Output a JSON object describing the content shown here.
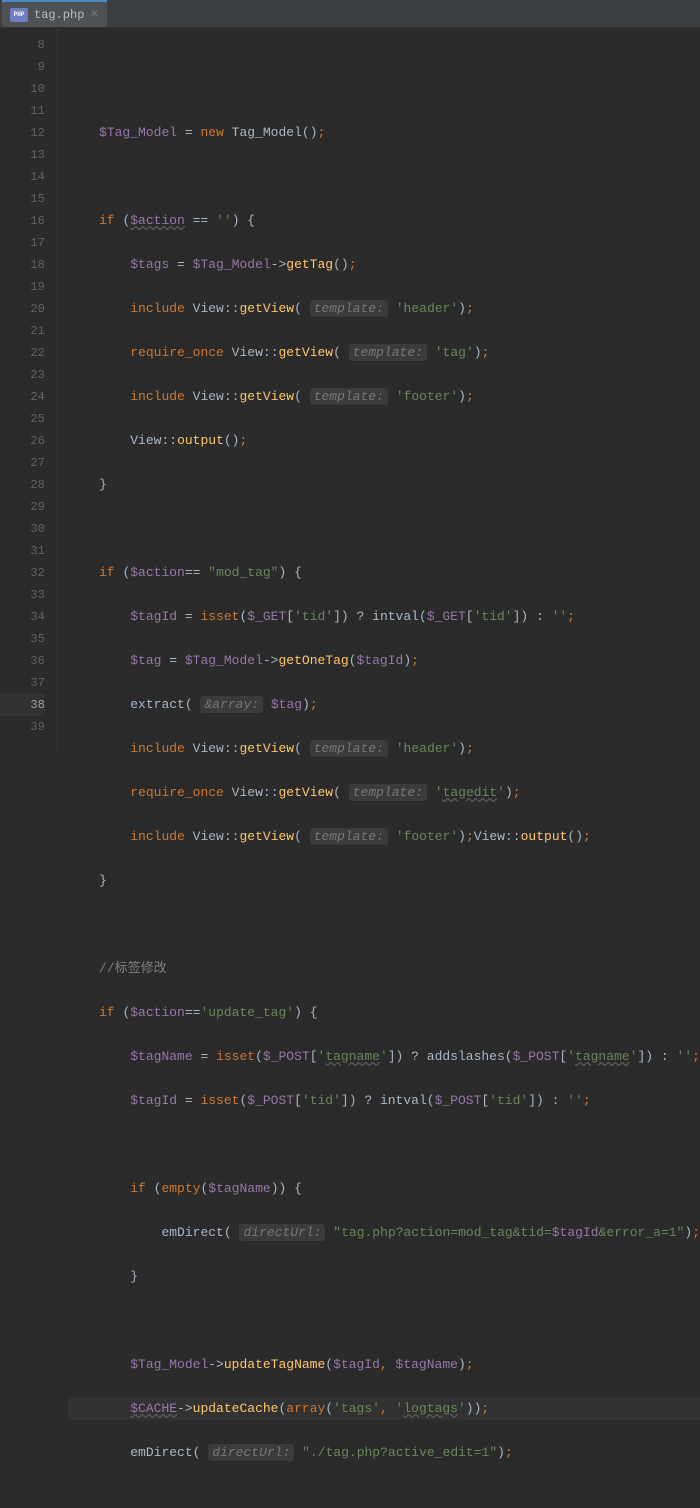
{
  "tab": {
    "filename": "tag.php",
    "icon_label": "PHP"
  },
  "lines": {
    "start": 8,
    "end": 39,
    "highlight": 38
  },
  "code": {
    "l9_var": "$Tag_Model",
    "l9_new": "new",
    "l9_cls": "Tag_Model",
    "l11_if": "if",
    "l11_var": "$action",
    "l11_eq": " == ",
    "l11_str": "''",
    "l12_var": "$tags",
    "l12_tm": "$Tag_Model",
    "l12_fn": "getTag",
    "l13_inc": "include",
    "l13_cls": "View",
    "l13_fn": "getView",
    "l13_hint": "template:",
    "l13_str": "'header'",
    "l14_req": "require_once",
    "l14_cls": "View",
    "l14_fn": "getView",
    "l14_hint": "template:",
    "l14_str": "'tag'",
    "l15_inc": "include",
    "l15_cls": "View",
    "l15_fn": "getView",
    "l15_hint": "template:",
    "l15_str": "'footer'",
    "l16_cls": "View",
    "l16_fn": "output",
    "l19_if": "if",
    "l19_var": "$action",
    "l19_eq": "== ",
    "l19_str": "\"mod_tag\"",
    "l20_var": "$tagId",
    "l20_isset": "isset",
    "l20_get": "$_GET",
    "l20_k": "'tid'",
    "l20_intval": "intval",
    "l20_emp": "''",
    "l21_var": "$tag",
    "l21_tm": "$Tag_Model",
    "l21_fn": "getOneTag",
    "l21_arg": "$tagId",
    "l22_fn": "extract",
    "l22_hint": "&array:",
    "l22_arg": "$tag",
    "l23_inc": "include",
    "l23_cls": "View",
    "l23_fn": "getView",
    "l23_hint": "template:",
    "l23_str": "'header'",
    "l24_req": "require_once",
    "l24_cls": "View",
    "l24_fn": "getView",
    "l24_hint": "template:",
    "l24_str": "tagedit",
    "l25_inc": "include",
    "l25_cls": "View",
    "l25_fn": "getView",
    "l25_hint": "template:",
    "l25_str": "'footer'",
    "l25_cls2": "View",
    "l25_fn2": "output",
    "l28_comment": "//标签修改",
    "l29_if": "if",
    "l29_var": "$action",
    "l29_eq": "==",
    "l29_str": "'update_tag'",
    "l30_var": "$tagName",
    "l30_isset": "isset",
    "l30_post": "$_POST",
    "l30_k": "tagname",
    "l30_fn": "addslashes",
    "l30_emp": "''",
    "l31_var": "$tagId",
    "l31_isset": "isset",
    "l31_post": "$_POST",
    "l31_k": "'tid'",
    "l31_intval": "intval",
    "l31_emp": "''",
    "l33_if": "if",
    "l33_fn": "empty",
    "l33_arg": "$tagName",
    "l34_fn": "emDirect",
    "l34_hint": "directUrl:",
    "l34_str": "\"tag.php?action=mod_tag&tid=",
    "l34_var": "$tagId",
    "l34_str2": "&error_a=1\"",
    "l37_tm": "$Tag_Model",
    "l37_fn": "updateTagName",
    "l37_a1": "$tagId",
    "l37_a2": "$tagName",
    "l38_cache": "$CACHE",
    "l38_fn": "updateCache",
    "l38_arr": "array",
    "l38_s1": "'tags'",
    "l38_s2": "logtags",
    "l39_fn": "emDirect",
    "l39_hint": "directUrl:",
    "l39_str": "\"./tag.php?active_edit=1\""
  }
}
